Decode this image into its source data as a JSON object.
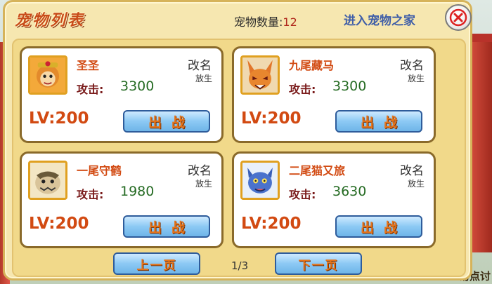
{
  "panel": {
    "title": "宠物列表",
    "pet_count_label": "宠物数量:",
    "pet_count_value": "12",
    "enter_home_label": "进入宠物之家"
  },
  "pets": [
    {
      "name": "圣圣",
      "attack_label": "攻击:",
      "attack": "3300",
      "level": "LV:200",
      "rename_label": "改名",
      "release_label": "放生",
      "battle_label": "出战"
    },
    {
      "name": "九尾藏马",
      "attack_label": "攻击:",
      "attack": "3300",
      "level": "LV:200",
      "rename_label": "改名",
      "release_label": "放生",
      "battle_label": "出战"
    },
    {
      "name": "一尾守鹤",
      "attack_label": "攻击:",
      "attack": "1980",
      "level": "LV:200",
      "rename_label": "改名",
      "release_label": "放生",
      "battle_label": "出战"
    },
    {
      "name": "二尾猫又旅",
      "attack_label": "攻击:",
      "attack": "3630",
      "level": "LV:200",
      "rename_label": "改名",
      "release_label": "放生",
      "battle_label": "出战"
    }
  ],
  "pager": {
    "prev_label": "上一页",
    "next_label": "下一页",
    "page_indicator": "1/3"
  },
  "background": {
    "partial_text": "易点讨"
  },
  "colors": {
    "title": "#c84b1a",
    "pet_name": "#d24a12",
    "attack_value": "#256b23",
    "link": "#3f5ea8",
    "button_fill": "#8cc9f4",
    "button_text": "#e6741a"
  }
}
